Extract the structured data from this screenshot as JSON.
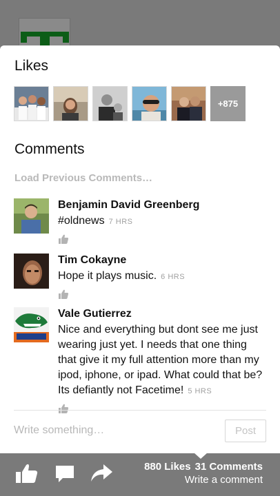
{
  "likes": {
    "title": "Likes",
    "more_count": "+875"
  },
  "comments": {
    "title": "Comments",
    "load_previous": "Load Previous Comments…",
    "items": [
      {
        "name": "Benjamin David Greenberg",
        "text": "#oldnews",
        "time": "7 HRS"
      },
      {
        "name": "Tim Cokayne",
        "text": "Hope it plays music.",
        "time": "6 HRS"
      },
      {
        "name": "Vale Gutierrez",
        "text": "Nice and everything but dont see me just wearing just yet. I needs that one thing that give it my full attention more than my ipod, iphone, or ipad. What could that be? Its defiantly not Facetime!",
        "time": "5 HRS"
      }
    ]
  },
  "composer": {
    "placeholder": "Write something…",
    "post_label": "Post"
  },
  "toolbar": {
    "likes_count": "880 Likes",
    "comments_count": "31 Comments",
    "write_comment": "Write a comment",
    "icons": [
      "like-icon",
      "comment-icon",
      "share-icon"
    ]
  },
  "colors": {
    "toolbar_bg": "#7a7a7a",
    "muted_text": "#a0a0a0"
  }
}
